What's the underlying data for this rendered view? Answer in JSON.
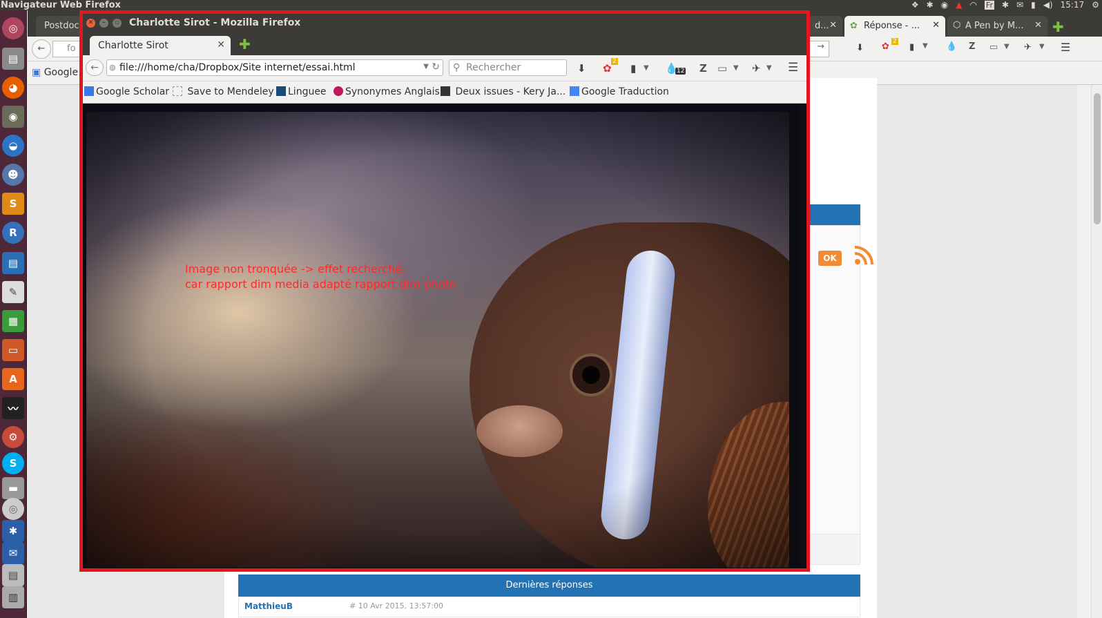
{
  "top_panel": {
    "app_title": "Navigateur Web Firefox",
    "keyboard": "Fr",
    "clock": "15:17"
  },
  "background_window": {
    "tabs": [
      {
        "label": "Postdoc"
      },
      {
        "label": "d..."
      },
      {
        "label": "Réponse - ..."
      },
      {
        "label": "A Pen by M..."
      }
    ],
    "url_partial": "fo",
    "bookmark_partial": "Google",
    "badge_count": "2",
    "ok_button": "OK",
    "section_header": "Dernières réponses",
    "author_partial": "MatthieuB",
    "date_partial": "# 10 Avr 2015, 13:57:00"
  },
  "window": {
    "title": "Charlotte Sirot - Mozilla Firefox",
    "tab_label": "Charlotte Sirot",
    "url": "file:///home/cha/Dropbox/Site internet/essai.html",
    "search_placeholder": "Rechercher",
    "badge_count": "2",
    "drop_count": "12",
    "bookmarks": [
      {
        "label": "Google Scholar",
        "icon": "google-scholar-icon",
        "color": "#3b78e7"
      },
      {
        "label": "Save to Mendeley",
        "icon": "mendeley-icon",
        "color": "#999999"
      },
      {
        "label": "Linguee",
        "icon": "linguee-icon",
        "color": "#1a4a7a"
      },
      {
        "label": "Synonymes Anglais",
        "icon": "synonym-icon",
        "color": "#c2185b"
      },
      {
        "label": "Deux issues - Kery Ja...",
        "icon": "music-icon",
        "color": "#333333"
      },
      {
        "label": "Google Traduction",
        "icon": "google-translate-icon",
        "color": "#4285f4"
      }
    ]
  },
  "annotation": {
    "line1": "Image non tronquée -> effet recherché,",
    "line2": "car rapport dim media adapté rapport dim photo"
  },
  "colors": {
    "highlight_border": "#e3161d",
    "annotation_text": "#ff2a2a",
    "launcher": "#4e2838",
    "forum_blue": "#2272b4"
  }
}
